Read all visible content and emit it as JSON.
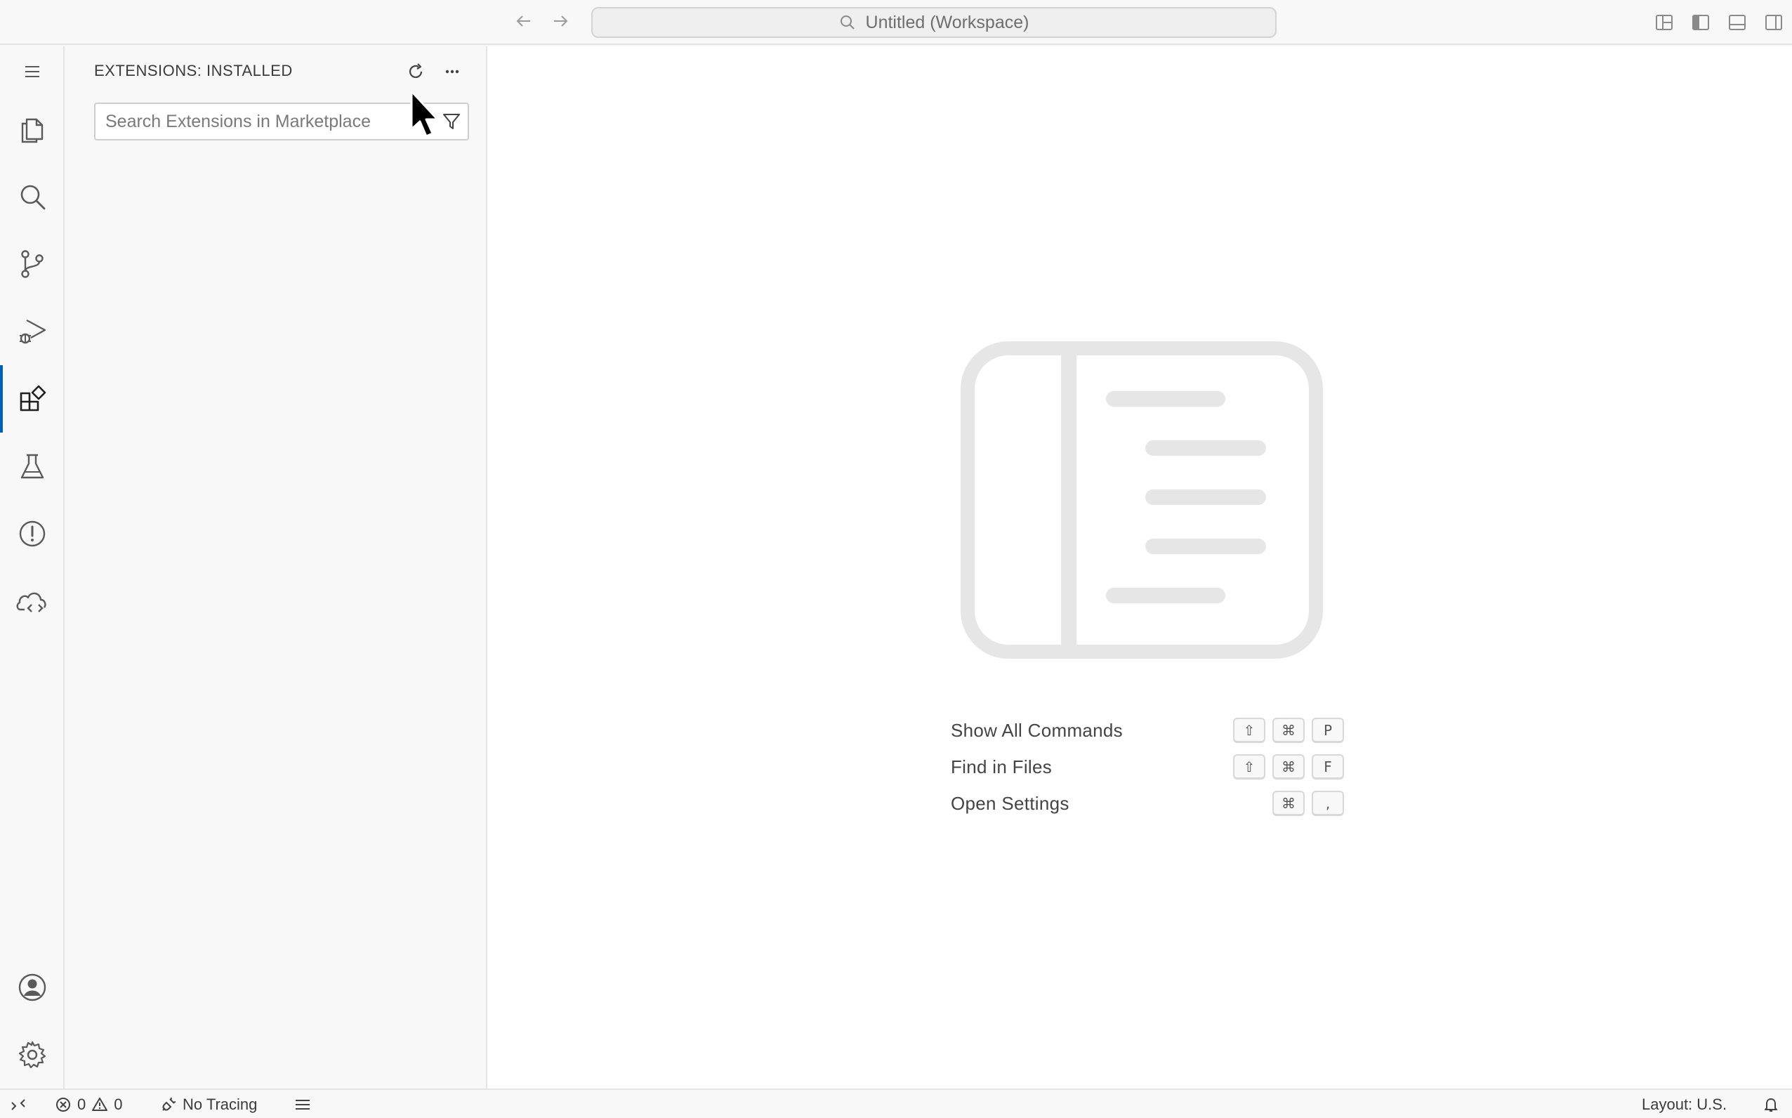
{
  "titlebar": {
    "command_center": "Untitled (Workspace)"
  },
  "activity_bar": {
    "items": [
      "explorer-icon",
      "search-icon",
      "source-control-icon",
      "run-debug-icon",
      "extensions-icon",
      "testing-icon",
      "problems-icon",
      "remote-explorer-icon"
    ],
    "bottom": [
      "accounts-icon",
      "manage-gear-icon"
    ],
    "active": "extensions-icon",
    "accent": "#005fb8"
  },
  "sidebar": {
    "title": "EXTENSIONS: INSTALLED",
    "search_placeholder": "Search Extensions in Marketplace"
  },
  "editor": {
    "shortcuts": [
      {
        "label": "Show All Commands",
        "keys": [
          "⇧",
          "⌘",
          "P"
        ]
      },
      {
        "label": "Find in Files",
        "keys": [
          "⇧",
          "⌘",
          "F"
        ]
      },
      {
        "label": "Open Settings",
        "keys": [
          "⌘",
          ","
        ]
      }
    ]
  },
  "statusbar": {
    "errors": "0",
    "warnings": "0",
    "tracing": "No Tracing",
    "layout": "Layout: U.S."
  }
}
